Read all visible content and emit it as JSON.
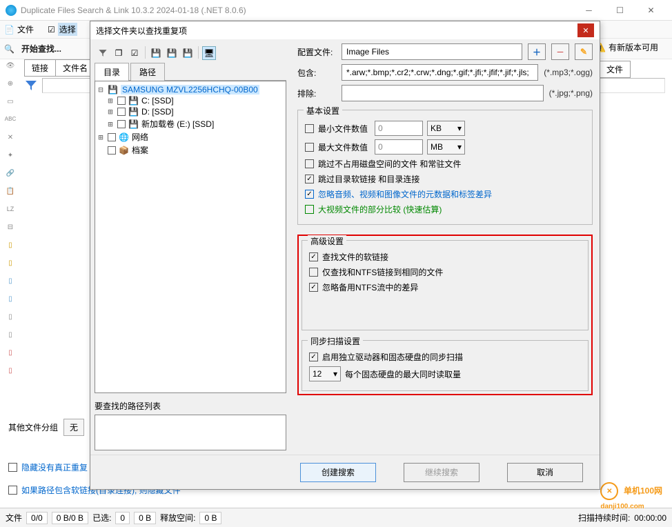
{
  "window": {
    "title": "Duplicate Files Search & Link 10.3.2 2024-01-18 (.NET 8.0.6)"
  },
  "menubar": {
    "file": "文件",
    "select": "选择"
  },
  "toolbar": {
    "start_search": "开始查找..."
  },
  "main_tabs": {
    "link": "链接",
    "filename": "文件名",
    "file": "文件"
  },
  "other_group": {
    "label": "其他文件分组",
    "none": "无"
  },
  "checks": {
    "hide_no_dup": "隐藏没有真正重复",
    "soft_path": "如果路径包含软链接(目录连接), 则隐藏文件"
  },
  "new_version": "有新版本可用",
  "status": {
    "file": "文件",
    "c1": "0/0",
    "c2": "0 B/0 B",
    "scanned": "已选:",
    "s1": "0",
    "s2": "0 B",
    "free": "释放空间:",
    "f1": "0 B",
    "scan_time": "扫描持续时间:",
    "t": "00:00:00"
  },
  "watermark": {
    "text": "单机100网",
    "url": "danji100.com"
  },
  "dialog": {
    "title": "选择文件夹以查找重复项",
    "tabs": {
      "dir": "目录",
      "path": "路径"
    },
    "tree": {
      "root": "SAMSUNG MZVL2256HCHQ-00B00",
      "c": "C: [SSD]",
      "d": "D: [SSD]",
      "e": "新加载卷 (E:) [SSD]",
      "network": "网络",
      "archive": "档案"
    },
    "path_list_label": "要查找的路径列表",
    "config": {
      "label": "配置文件:",
      "value": "Image Files"
    },
    "include": {
      "label": "包含:",
      "value": "*.arw;*.bmp;*.cr2;*.crw;*.dng;*.gif;*.jfi;*.jfif;*.jif;*.jls;",
      "hint": "(*.mp3;*.ogg)"
    },
    "exclude": {
      "label": "排除:",
      "hint": "(*.jpg;*.png)"
    },
    "basic": {
      "legend": "基本设置",
      "min_size": "最小文件数值",
      "min_val": "0",
      "min_unit": "KB",
      "max_size": "最大文件数值",
      "max_val": "0",
      "max_unit": "MB",
      "skip_zero": "跳过不占用磁盘空间的文件 和常驻文件",
      "skip_sym": "跳过目录软链接 和目录连接",
      "ignore_meta": "忽略音频、视频和图像文件的元数据和标签差异",
      "partial": "大视频文件的部分比较 (快速估算)"
    },
    "advanced": {
      "legend": "高级设置",
      "find_soft": "查找文件的软链接",
      "only_ntfs": "仅查找和NTFS链接到相同的文件",
      "ignore_ntfs": "忽略备用NTFS流中的差异"
    },
    "sync": {
      "legend": "同步扫描设置",
      "enable": "启用独立驱动器和固态硬盘的同步扫描",
      "concurrent": "12",
      "concurrent_label": "每个固态硬盘的最大同时读取量"
    },
    "buttons": {
      "create": "创建搜索",
      "continue": "继续搜索",
      "cancel": "取消"
    }
  }
}
